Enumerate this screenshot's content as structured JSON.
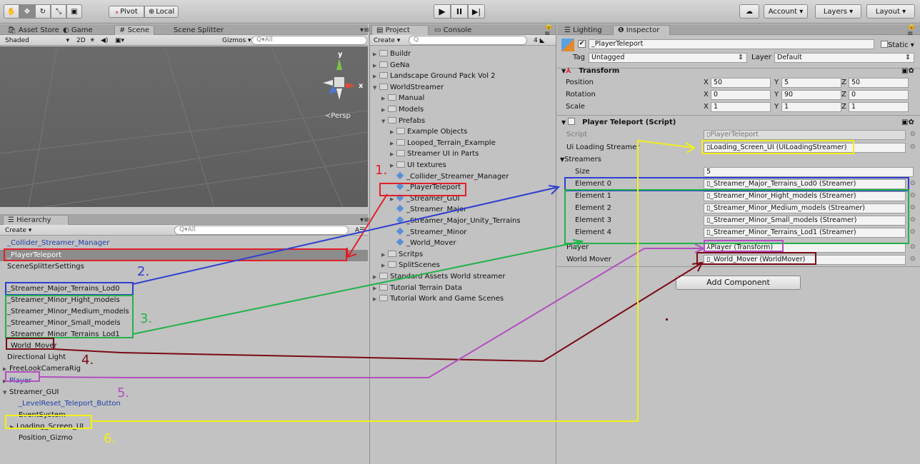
{
  "top_toolbar": {
    "tool_icons": [
      "hand-icon",
      "move-icon",
      "rotate-icon",
      "scale-icon",
      "rect-icon"
    ],
    "pivot": "Pivot",
    "local": "Local",
    "cloud": "☁",
    "account": "Account",
    "layers": "Layers",
    "layout": "Layout"
  },
  "scene_panel": {
    "tabs": [
      "Asset Store",
      "Game",
      "Scene",
      "Scene Splitter"
    ],
    "shading": "Shaded",
    "mode_2d": "2D",
    "gizmos": "Gizmos",
    "search_placeholder": "Q▾All",
    "gizmo_y": "y",
    "gizmo_x": "x",
    "persp": "≺Persp"
  },
  "hierarchy": {
    "tab": "Hierarchy",
    "create": "Create",
    "search_placeholder": "Q▾All",
    "items": [
      {
        "label": "_Collider_Streamer_Manager",
        "color": "#1f3fa8"
      },
      {
        "label": "_PlayerTeleport",
        "color": "#ffffff"
      },
      {
        "label": "SceneSplitterSettings",
        "color": "#111111"
      },
      {
        "label": "_Streamer_Major_Terrains_Lod0",
        "color": "#111111"
      },
      {
        "label": "_Streamer_Minor_Hight_models",
        "color": "#111111"
      },
      {
        "label": "_Streamer_Minor_Medium_models",
        "color": "#111111"
      },
      {
        "label": "_Streamer_Minor_Small_models",
        "color": "#111111"
      },
      {
        "label": "_Streamer_Minor_Terrains_Lod1",
        "color": "#111111"
      },
      {
        "label": "_World_Mover",
        "color": "#111111"
      },
      {
        "label": "Directional Light",
        "color": "#111111"
      },
      {
        "label": "FreeLookCameraRig",
        "color": "#111111"
      },
      {
        "label": "Player",
        "color": "#1f3fa8"
      },
      {
        "label": "Streamer_GUI",
        "color": "#111111"
      },
      {
        "label": "_LevelReset_Teleport_Button",
        "color": "#1f3fa8"
      },
      {
        "label": "EventSystem",
        "color": "#111111"
      },
      {
        "label": "Loading_Screen_UI",
        "color": "#111111"
      },
      {
        "label": "Position_Gizmo",
        "color": "#111111"
      }
    ]
  },
  "project": {
    "tabs": [
      "Project",
      "Console"
    ],
    "create": "Create",
    "search_placeholder": "Q",
    "count": "4",
    "items": [
      {
        "label": "Buildr",
        "kind": "folder",
        "indent": 0,
        "arrow": "▶"
      },
      {
        "label": "GeNa",
        "kind": "folder",
        "indent": 0,
        "arrow": "▶"
      },
      {
        "label": "Landscape Ground Pack  Vol 2",
        "kind": "folder",
        "indent": 0,
        "arrow": "▶"
      },
      {
        "label": "WorldStreamer",
        "kind": "folder",
        "indent": 0,
        "arrow": "▼"
      },
      {
        "label": "Manual",
        "kind": "folder",
        "indent": 1,
        "arrow": "▶"
      },
      {
        "label": "Models",
        "kind": "folder",
        "indent": 1,
        "arrow": "▶"
      },
      {
        "label": "Prefabs",
        "kind": "folder",
        "indent": 1,
        "arrow": "▼"
      },
      {
        "label": "Example Objects",
        "kind": "folder",
        "indent": 2,
        "arrow": "▶"
      },
      {
        "label": "Looped_Terrain_Example",
        "kind": "folder",
        "indent": 2,
        "arrow": "▶"
      },
      {
        "label": "Streamer UI in Parts",
        "kind": "folder",
        "indent": 2,
        "arrow": "▶"
      },
      {
        "label": "UI textures",
        "kind": "folder",
        "indent": 2,
        "arrow": "▶"
      },
      {
        "label": "_Collider_Streamer_Manager",
        "kind": "prefab",
        "indent": 2,
        "arrow": ""
      },
      {
        "label": "_PlayerTeleport",
        "kind": "prefab",
        "indent": 2,
        "arrow": ""
      },
      {
        "label": "_Streamer_GUI",
        "kind": "prefab",
        "indent": 2,
        "arrow": "▶"
      },
      {
        "label": "_Streamer_Major",
        "kind": "prefab",
        "indent": 2,
        "arrow": ""
      },
      {
        "label": "_Streamer_Major_Unity_Terrains",
        "kind": "prefab",
        "indent": 2,
        "arrow": ""
      },
      {
        "label": "_Streamer_Minor",
        "kind": "prefab",
        "indent": 2,
        "arrow": ""
      },
      {
        "label": "_World_Mover",
        "kind": "prefab",
        "indent": 2,
        "arrow": ""
      },
      {
        "label": "Scritps",
        "kind": "folder",
        "indent": 1,
        "arrow": "▶"
      },
      {
        "label": "SplitScenes",
        "kind": "folder",
        "indent": 1,
        "arrow": "▶"
      },
      {
        "label": "Standard Assets World streamer",
        "kind": "folder",
        "indent": 0,
        "arrow": "▶"
      },
      {
        "label": "Tutorial Terrain Data",
        "kind": "folder",
        "indent": 0,
        "arrow": "▶"
      },
      {
        "label": "Tutorial Work and Game Scenes",
        "kind": "folder",
        "indent": 0,
        "arrow": "▶"
      }
    ]
  },
  "inspector": {
    "tabs": [
      "Lighting",
      "Inspector"
    ],
    "object_name": "_PlayerTeleport",
    "static": "Static",
    "tag_label": "Tag",
    "tag_value": "Untagged",
    "layer_label": "Layer",
    "layer_value": "Default",
    "transform": {
      "title": "Transform",
      "rows": [
        {
          "label": "Position",
          "x": "50",
          "y": "5",
          "z": "50"
        },
        {
          "label": "Rotation",
          "x": "0",
          "y": "90",
          "z": "0"
        },
        {
          "label": "Scale",
          "x": "1",
          "y": "1",
          "z": "1"
        }
      ],
      "axis_x": "X",
      "axis_y": "Y",
      "axis_z": "Z"
    },
    "script": {
      "title": "Player Teleport (Script)",
      "script_label": "Script",
      "script_value": "PlayerTeleport",
      "ui_label": "Ui Loading Streamer",
      "ui_value": "Loading_Screen_UI (UILoadingStreamer)",
      "streamers_label": "Streamers",
      "size_label": "Size",
      "size_value": "5",
      "elements": [
        {
          "label": "Element 0",
          "value": "_Streamer_Major_Terrains_Lod0 (Streamer)"
        },
        {
          "label": "Element 1",
          "value": "_Streamer_Minor_Hight_models (Streamer)"
        },
        {
          "label": "Element 2",
          "value": "_Streamer_Minor_Medium_models (Streamer)"
        },
        {
          "label": "Element 3",
          "value": "_Streamer_Minor_Small_models (Streamer)"
        },
        {
          "label": "Element 4",
          "value": "_Streamer_Minor_Terrains_Lod1 (Streamer)"
        }
      ],
      "player_label": "Player",
      "player_value": "Player (Transform)",
      "mover_label": "World Mover",
      "mover_value": "_World_Mover (WorldMover)"
    },
    "add_component": "Add Component"
  },
  "annotations": {
    "n1": "1.",
    "n2": "2.",
    "n3": "3.",
    "n4": "4.",
    "n5": "5.",
    "n6": "6.",
    "colors": {
      "red": "#e0202a",
      "blue": "#2f3fd0",
      "green": "#22b24a",
      "darkred": "#7a0a14",
      "purple": "#b34fc0",
      "yellow": "#f2ef1a"
    }
  }
}
